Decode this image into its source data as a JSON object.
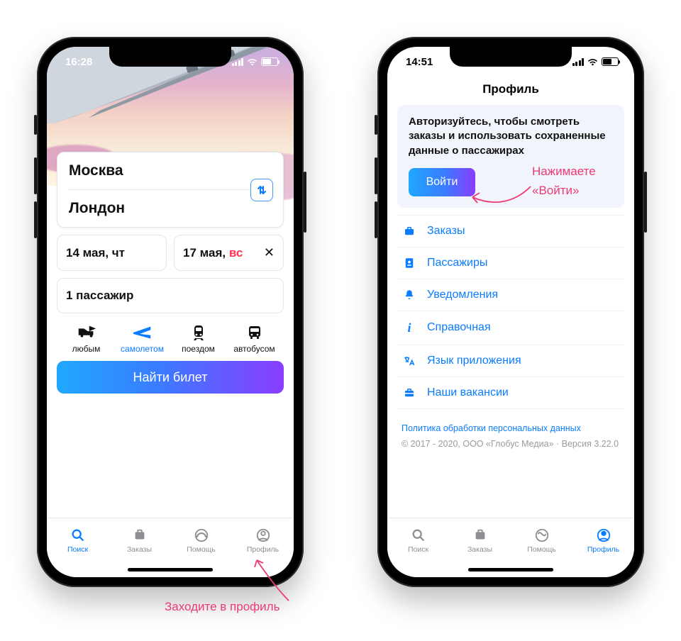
{
  "left": {
    "status_time": "16:28",
    "from_city": "Москва",
    "to_city": "Лондон",
    "depart": {
      "full": "14 мая, чт"
    },
    "return": {
      "date": "17 мая, ",
      "weekday": "вс"
    },
    "passengers": "1 пассажир",
    "transport": {
      "any": "любым",
      "plane": "самолетом",
      "train": "поездом",
      "bus": "автобусом"
    },
    "find_button": "Найти билет",
    "tabs": {
      "search": "Поиск",
      "orders": "Заказы",
      "help": "Помощь",
      "profile": "Профиль"
    }
  },
  "right": {
    "status_time": "14:51",
    "title": "Профиль",
    "auth_message": "Авторизуйтесь, чтобы смотреть заказы и использовать сохраненные данные о пассажирах",
    "login_button": "Войти",
    "menu": {
      "orders": "Заказы",
      "passengers": "Пассажиры",
      "notifications": "Уведомления",
      "reference": "Справочная",
      "language": "Язык приложения",
      "jobs": "Наши вакансии"
    },
    "policy_link": "Политика обработки персональных данных",
    "copyright": "© 2017 - 2020, ООО «Глобус Медиа» · Версия 3.22.0",
    "tabs": {
      "search": "Поиск",
      "orders": "Заказы",
      "help": "Помощь",
      "profile": "Профиль"
    }
  },
  "annotations": {
    "profile_hint": "Заходите в профиль",
    "login_hint_l1": "Нажимаете",
    "login_hint_l2": "«Войти»"
  }
}
